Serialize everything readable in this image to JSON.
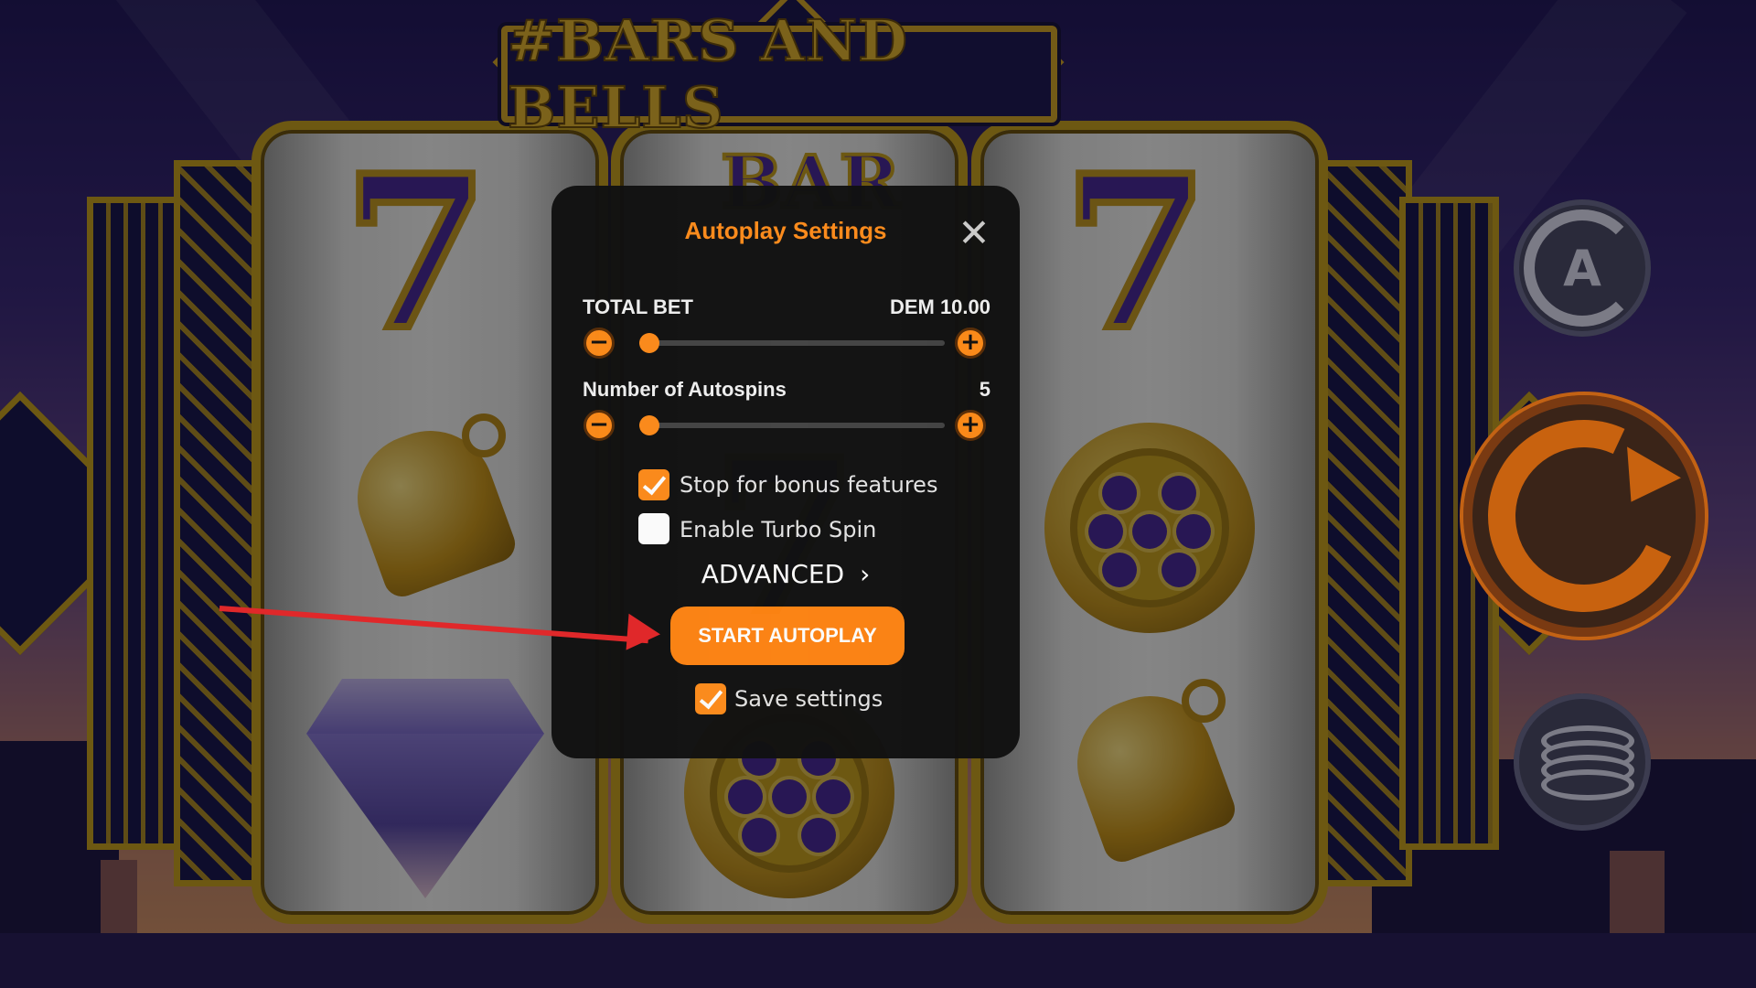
{
  "game": {
    "logo_text": "#BARS AND BELLS",
    "reel_symbols": [
      "seven-symbol",
      "bell-symbol",
      "diamond-symbol",
      "bar-symbol",
      "seven-symbol",
      "coin-symbol",
      "seven-symbol",
      "coin-symbol",
      "bell-symbol"
    ]
  },
  "controls": {
    "autoplay_letter": "A",
    "icons": [
      "autoplay-icon",
      "spin-icon",
      "coins-icon"
    ]
  },
  "modal": {
    "title": "Autoplay Settings",
    "close_glyph": "✕",
    "total_bet": {
      "label": "TOTAL BET",
      "value": "DEM 10.00",
      "slider_fraction": 0.0
    },
    "autospins": {
      "label": "Number of Autospins",
      "value": "5",
      "slider_fraction": 0.0
    },
    "minus_glyph": "−",
    "plus_glyph": "+",
    "options": [
      {
        "label": "Stop for bonus features",
        "checked": true
      },
      {
        "label": "Enable Turbo Spin",
        "checked": false
      }
    ],
    "advanced_label": "ADVANCED",
    "advanced_chevron": "›",
    "start_label": "START AUTOPLAY",
    "save_label": "Save settings",
    "save_checked": true
  },
  "colors": {
    "accent": "#ff8c1a",
    "gold": "#c7a022",
    "annotation_arrow": "#e0282a"
  }
}
